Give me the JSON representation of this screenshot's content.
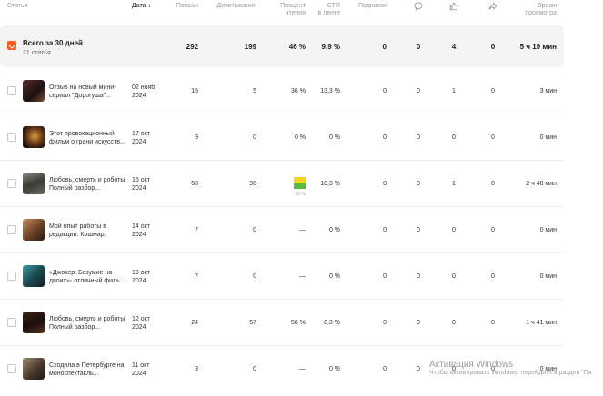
{
  "header": {
    "article": "Статья",
    "date": "Дата",
    "views": "Показы",
    "readthroughs": "Дочитывания",
    "read_percent_1": "Процент",
    "read_percent_2": "чтения",
    "ctr_1": "CTR",
    "ctr_2": "в ленте",
    "subs": "Подписки",
    "time_1": "Время",
    "time_2": "просмотра"
  },
  "summary": {
    "title": "Всего за 30 дней",
    "count": "21 статья",
    "views": "292",
    "readthroughs": "199",
    "read_percent": "46 %",
    "ctr": "9,9 %",
    "subs": "0",
    "comments": "0",
    "likes": "4",
    "reposts": "0",
    "time": "5 ч 19 мин"
  },
  "rows": [
    {
      "title": "Отзыв на новый мини-сериал \"Дорогуша\"...",
      "date_1": "02 нояб",
      "date_2": "2024",
      "views": "15",
      "readthroughs": "5",
      "read_percent": "36 %",
      "ctr": "13,3 %",
      "subs": "0",
      "comments": "0",
      "likes": "1",
      "reposts": "0",
      "time": "3 мин"
    },
    {
      "title": "Этот провокационный фильм о грани искусств...",
      "date_1": "17 окт",
      "date_2": "2024",
      "views": "9",
      "readthroughs": "0",
      "read_percent": "0 %",
      "ctr": "0 %",
      "subs": "0",
      "comments": "0",
      "likes": "0",
      "reposts": "0",
      "time": "0 мин"
    },
    {
      "title": "Любовь, смерть и роботы. Полный разбор...",
      "date_1": "15 окт",
      "date_2": "2024",
      "views": "58",
      "readthroughs": "98",
      "read_percent": "",
      "bar_label": "43 %",
      "bar_fraction": 0.43,
      "ctr": "10,3 %",
      "subs": "0",
      "comments": "0",
      "likes": "1",
      "reposts": "0",
      "time": "2 ч 48 мин"
    },
    {
      "title": "Мой опыт работы в редакции. Кошмар.",
      "date_1": "14 окт",
      "date_2": "2024",
      "views": "7",
      "readthroughs": "0",
      "read_percent": "—",
      "ctr": "0 %",
      "subs": "0",
      "comments": "0",
      "likes": "0",
      "reposts": "0",
      "time": "0 мин"
    },
    {
      "title": "«Джокер: Безумие на двоих»- отличный филь...",
      "date_1": "13 окт",
      "date_2": "2024",
      "views": "7",
      "readthroughs": "0",
      "read_percent": "—",
      "ctr": "0 %",
      "subs": "0",
      "comments": "0",
      "likes": "0",
      "reposts": "0",
      "time": "0 мин"
    },
    {
      "title": "Любовь, смерть и роботы. Полный разбор...",
      "date_1": "12 окт",
      "date_2": "2024",
      "views": "24",
      "readthroughs": "57",
      "read_percent": "58 %",
      "ctr": "8,3 %",
      "subs": "0",
      "comments": "0",
      "likes": "0",
      "reposts": "0",
      "time": "1 ч 41 мин"
    },
    {
      "title": "Сходила в Петербурге на моноспектакль...",
      "date_1": "11 окт",
      "date_2": "2024",
      "views": "3",
      "readthroughs": "0",
      "read_percent": "—",
      "ctr": "0 %",
      "subs": "0",
      "comments": "0",
      "likes": "0",
      "reposts": "0",
      "time": "0 мин"
    }
  ],
  "icons": {
    "comments": "comment-icon",
    "likes": "like-icon",
    "reposts": "share-icon"
  },
  "watermark": {
    "line1": "Активация Windows",
    "line2": "Чтобы активировать Windows, перейдите в раздел \"Па"
  },
  "colors": {
    "accent": "#ff5a1f",
    "bar_green": "#58bb3c",
    "bar_yellow": "#f1d61f"
  }
}
